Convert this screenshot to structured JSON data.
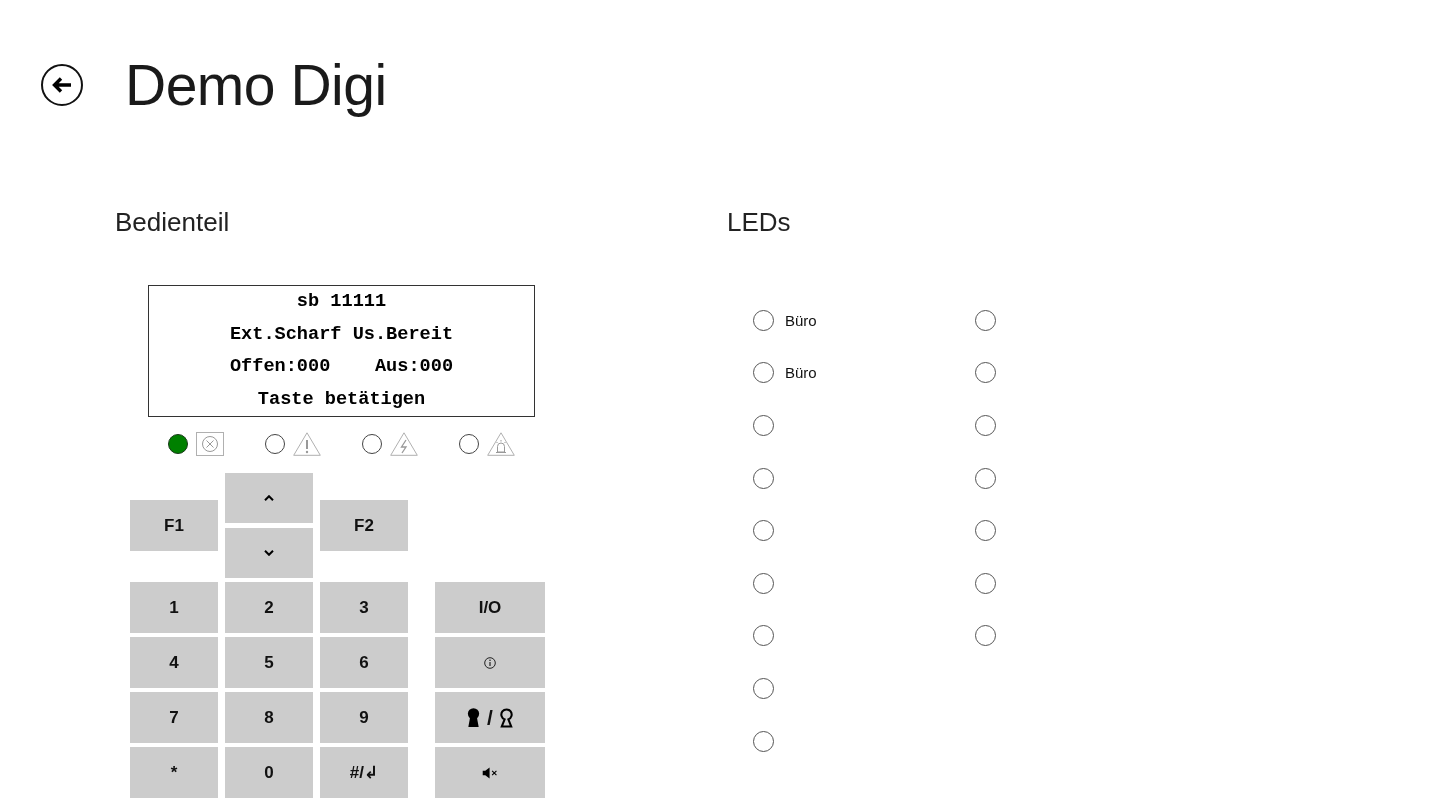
{
  "header": {
    "title": "Demo Digi"
  },
  "panel": {
    "title": "Bedienteil",
    "display": {
      "lines": [
        "sb 11111",
        "Ext.Scharf Us.Bereit",
        "Offen:000    Aus:000",
        "Taste betätigen"
      ]
    },
    "status_leds": [
      {
        "kind": "cross",
        "on": true
      },
      {
        "kind": "warning",
        "on": false
      },
      {
        "kind": "lightning",
        "on": false
      },
      {
        "kind": "siren",
        "on": false
      }
    ],
    "nav_keys": [
      {
        "kind": "text",
        "label": "F1"
      },
      {
        "kind": "up"
      },
      {
        "kind": "down"
      },
      {
        "kind": "text",
        "label": "F2"
      }
    ],
    "keys": [
      [
        {
          "kind": "text",
          "label": "1"
        },
        {
          "kind": "text",
          "label": "2"
        },
        {
          "kind": "text",
          "label": "3"
        },
        {
          "kind": "text",
          "label": "I/O"
        }
      ],
      [
        {
          "kind": "text",
          "label": "4"
        },
        {
          "kind": "text",
          "label": "5"
        },
        {
          "kind": "text",
          "label": "6"
        },
        {
          "kind": "info"
        }
      ],
      [
        {
          "kind": "text",
          "label": "7"
        },
        {
          "kind": "text",
          "label": "8"
        },
        {
          "kind": "text",
          "label": "9"
        },
        {
          "kind": "lock",
          "label": "/"
        }
      ],
      [
        {
          "kind": "text",
          "label": "*"
        },
        {
          "kind": "text",
          "label": "0"
        },
        {
          "kind": "text",
          "label": "#/↲"
        },
        {
          "kind": "mute"
        }
      ]
    ]
  },
  "leds": {
    "title": "LEDs",
    "columns": [
      [
        {
          "label": "Büro",
          "on": false
        },
        {
          "label": "Büro",
          "on": false
        },
        {
          "on": false
        },
        {
          "on": false
        },
        {
          "on": false
        },
        {
          "on": false
        },
        {
          "on": false
        },
        {
          "on": false
        },
        {
          "on": false
        }
      ],
      [
        {
          "on": false
        },
        {
          "on": false
        },
        {
          "on": false
        },
        {
          "on": false
        },
        {
          "on": false
        },
        {
          "on": false
        },
        {
          "on": false
        }
      ]
    ]
  }
}
